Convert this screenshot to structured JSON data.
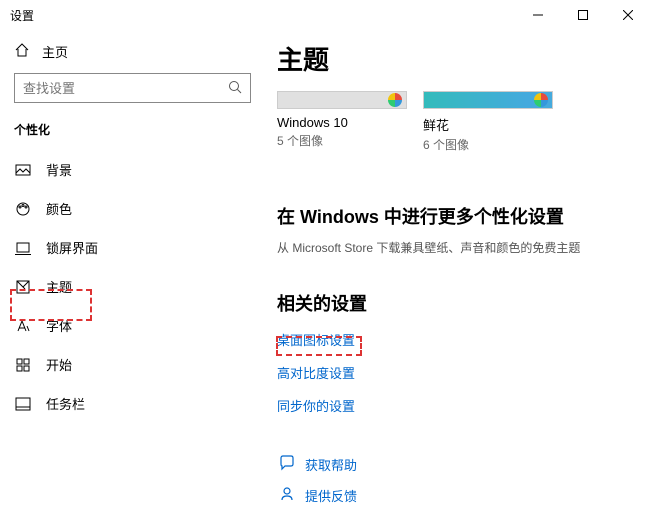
{
  "window": {
    "title": "设置"
  },
  "sidebar": {
    "home": "主页",
    "searchPlaceholder": "查找设置",
    "section": "个性化",
    "items": [
      {
        "label": "背景"
      },
      {
        "label": "颜色"
      },
      {
        "label": "锁屏界面"
      },
      {
        "label": "主题"
      },
      {
        "label": "字体"
      },
      {
        "label": "开始"
      },
      {
        "label": "任务栏"
      }
    ]
  },
  "content": {
    "title": "主题",
    "themes": [
      {
        "name": "Windows 10",
        "count": "5 个图像"
      },
      {
        "name": "鲜花",
        "count": "6 个图像"
      }
    ],
    "moreTitle": "在 Windows 中进行更多个性化设置",
    "moreSub": "从 Microsoft Store 下载兼具壁纸、声音和颜色的免费主题",
    "relatedTitle": "相关的设置",
    "links": {
      "desktopIcon": "桌面图标设置",
      "highContrast": "高对比度设置",
      "sync": "同步你的设置"
    },
    "help": "获取帮助",
    "feedback": "提供反馈"
  }
}
